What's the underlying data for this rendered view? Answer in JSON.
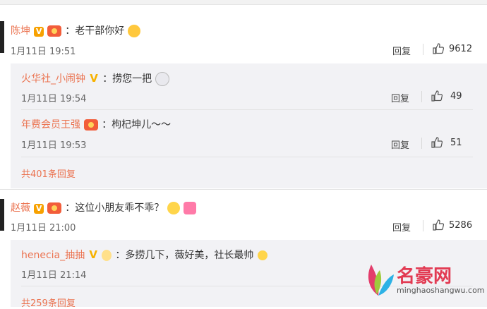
{
  "comments": [
    {
      "user": "陈坤",
      "text": "：老干部你好",
      "time": "1月11日 19:51",
      "reply_label": "回复",
      "likes": "9612",
      "replies": [
        {
          "user": "火华社_小闹钟",
          "text": "：捞您一把",
          "time": "1月11日 19:54",
          "reply_label": "回复",
          "likes": "49"
        },
        {
          "user": "年费会员王强",
          "text": "：枸杞坤儿～～",
          "time": "1月11日 19:53",
          "reply_label": "回复",
          "likes": "51"
        }
      ],
      "more": "共401条回复"
    },
    {
      "user": "赵薇",
      "text": "：这位小朋友乖不乖？",
      "time": "1月11日 21:00",
      "reply_label": "回复",
      "likes": "5286",
      "replies": [
        {
          "user": "henecia_抽抽",
          "text": "：多捞几下，薇好美，社长最帅",
          "time": "1月11日 21:14",
          "reply_label": "回复",
          "likes": ""
        }
      ],
      "more": "共259条回复"
    }
  ],
  "watermark": {
    "title": "名豪网",
    "url": "minghaoshangwu.com"
  },
  "colors": {
    "name": "#eb7350",
    "panel": "#f2f2f5",
    "vip": "#f7a100"
  },
  "icons": [
    "verified-v-icon",
    "vip-medal-icon",
    "thumbs-up-icon",
    "emoji-icon"
  ]
}
